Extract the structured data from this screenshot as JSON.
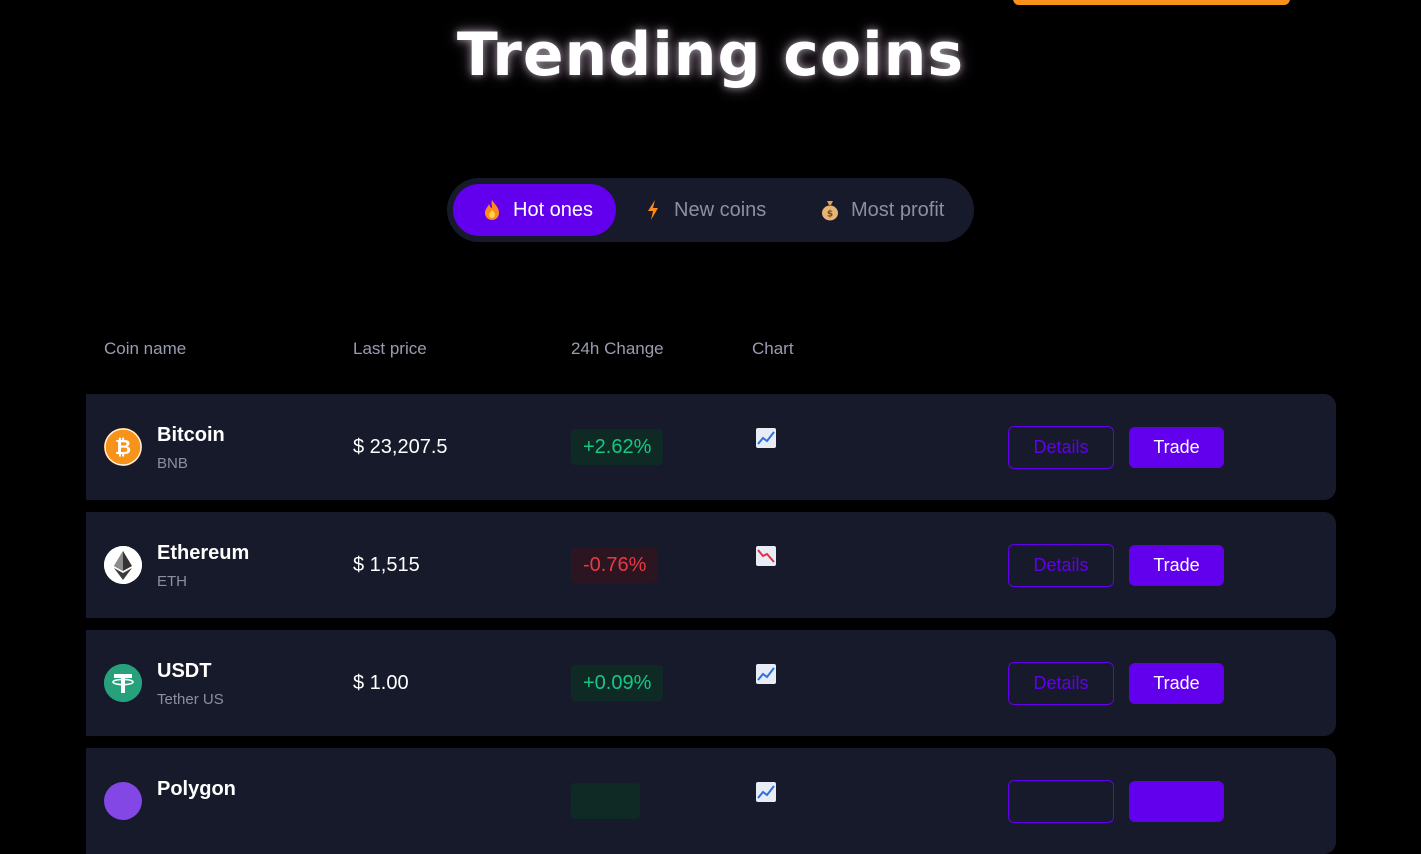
{
  "page": {
    "title": "Trending coins"
  },
  "tabs": [
    {
      "label": "Hot ones",
      "icon": "fire-icon",
      "active": true
    },
    {
      "label": "New coins",
      "icon": "lightning-icon",
      "active": false
    },
    {
      "label": "Most profit",
      "icon": "money-bag-icon",
      "active": false
    }
  ],
  "table": {
    "headers": [
      "Coin name",
      "Last price",
      "24h Change",
      "Chart"
    ],
    "rows": [
      {
        "name": "Bitcoin",
        "symbol": "BNB",
        "price": "$ 23,207.5",
        "change": "+2.62%",
        "trend": "up",
        "icon": "bitcoin-icon",
        "details_label": "Details",
        "trade_label": "Trade"
      },
      {
        "name": "Ethereum",
        "symbol": "ETH",
        "price": "$ 1,515",
        "change": "-0.76%",
        "trend": "down",
        "icon": "ethereum-icon",
        "details_label": "Details",
        "trade_label": "Trade"
      },
      {
        "name": "USDT",
        "symbol": "Tether US",
        "price": "$ 1.00",
        "change": "+0.09%",
        "trend": "up",
        "icon": "tether-icon",
        "details_label": "Details",
        "trade_label": "Trade"
      },
      {
        "name": "Polygon",
        "symbol": "",
        "price": "",
        "change": "",
        "trend": "up",
        "icon": "polygon-icon",
        "details_label": "",
        "trade_label": ""
      }
    ]
  },
  "colors": {
    "accent": "#6200ee",
    "positive": "#16c784",
    "negative": "#ea3943",
    "row_bg": "#171a2a",
    "highlight": "#f7931a"
  }
}
